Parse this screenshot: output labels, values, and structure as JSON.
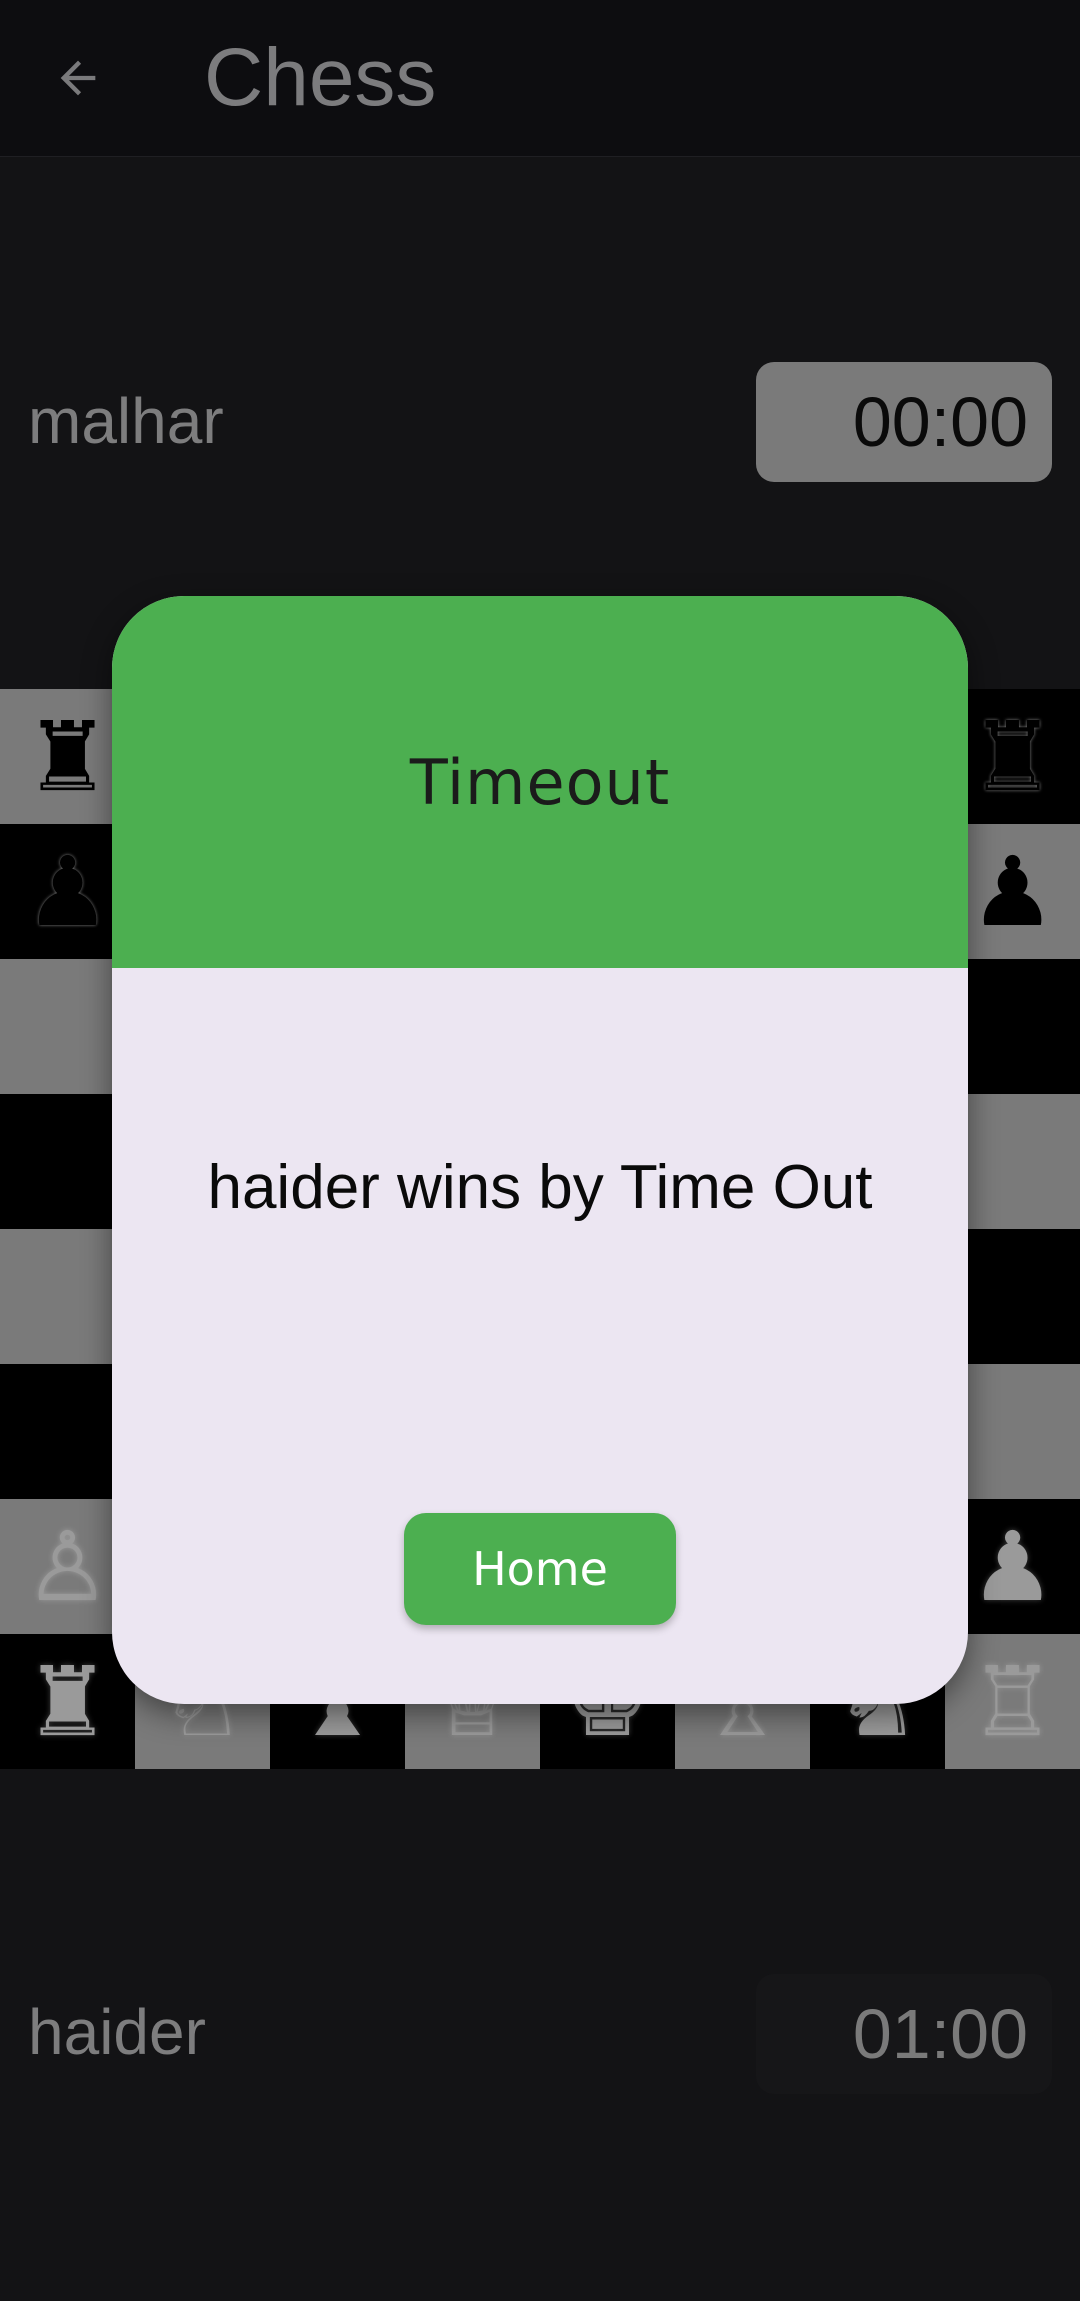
{
  "appbar": {
    "title": "Chess",
    "back_icon": "arrow-left-icon"
  },
  "players": {
    "top": {
      "name": "malhar",
      "time": "00:00"
    },
    "bottom": {
      "name": "haider",
      "time": "01:00"
    }
  },
  "dialog": {
    "title": "Timeout",
    "message": "haider wins by Time Out",
    "button_label": "Home"
  },
  "colors": {
    "accent_green": "#4caf50",
    "dialog_body": "#ece6f2",
    "board_light": "#7a7a7a",
    "board_dark": "#000000"
  }
}
